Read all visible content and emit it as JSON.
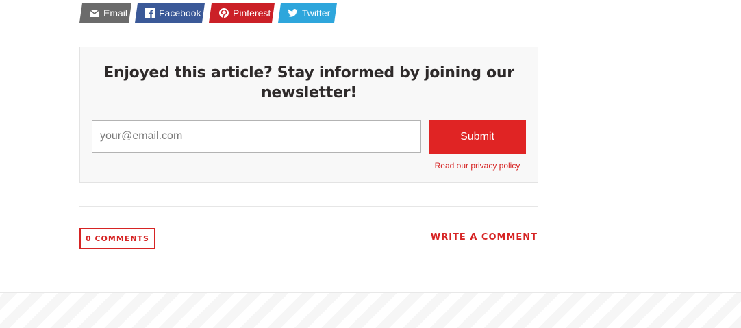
{
  "share": {
    "email": {
      "label": "Email",
      "icon": "envelope-icon",
      "color": "#6b6b6b"
    },
    "facebook": {
      "label": "Facebook",
      "icon": "facebook-icon",
      "color": "#3b5998"
    },
    "pinterest": {
      "label": "Pinterest",
      "icon": "pinterest-icon",
      "color": "#cb2027"
    },
    "twitter": {
      "label": "Twitter",
      "icon": "twitter-icon",
      "color": "#2ea6dc"
    }
  },
  "newsletter": {
    "title": "Enjoyed this article? Stay informed by joining our newsletter!",
    "email_placeholder": "your@email.com",
    "email_value": "",
    "submit_label": "Submit",
    "privacy_link": "Read our privacy policy"
  },
  "comments": {
    "count_label": "0 COMMENTS",
    "write_label": "WRITE A COMMENT"
  },
  "colors": {
    "accent": "#e02424",
    "title_text": "#2e2a2a",
    "box_background": "#f8f8f8"
  }
}
